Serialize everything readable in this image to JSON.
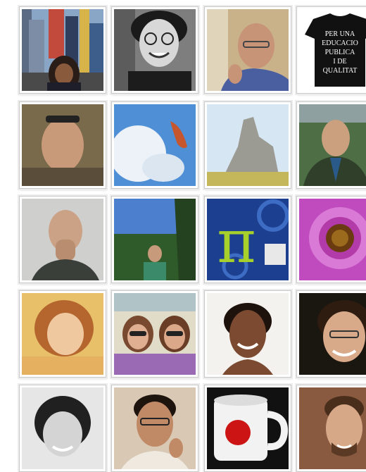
{
  "grid": {
    "tiles": [
      {
        "id": "times-square-woman"
      },
      {
        "id": "curly-hair-man-glasses"
      },
      {
        "id": "bald-man-glasses"
      },
      {
        "id": "tshirt-slogan",
        "text": [
          "PER UNA",
          "EDUCACIO",
          "PUBLICA",
          "I DE",
          "QUALITAT"
        ]
      },
      {
        "id": "man-with-sunglasses-on-head"
      },
      {
        "id": "sky-hand"
      },
      {
        "id": "rock-formation"
      },
      {
        "id": "man-green-hills"
      },
      {
        "id": "man-hand-on-mouth"
      },
      {
        "id": "man-forest"
      },
      {
        "id": "pi-symbol",
        "text": [
          "π"
        ]
      },
      {
        "id": "purple-flower"
      },
      {
        "id": "woman-curly-hair"
      },
      {
        "id": "two-girls-sunglasses"
      },
      {
        "id": "woman-smiling"
      },
      {
        "id": "young-man-smiling"
      },
      {
        "id": "girl-black-white"
      },
      {
        "id": "man-glasses-hand-chin"
      },
      {
        "id": "mug-red-dot"
      },
      {
        "id": "man-bearded"
      }
    ]
  }
}
